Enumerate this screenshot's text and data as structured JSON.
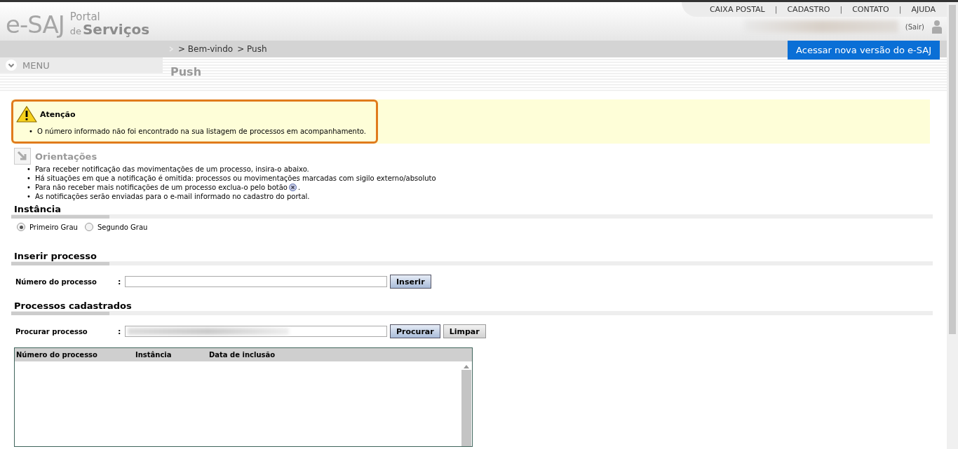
{
  "logo": {
    "mark": "e-SAJ",
    "line1": "Portal",
    "line2a": "de",
    "line2b": "Serviços"
  },
  "top_links": [
    "CAIXA POSTAL",
    "CADASTRO",
    "CONTATO",
    "AJUDA"
  ],
  "top_link_separators": [
    "|",
    "|",
    "|"
  ],
  "logout": "(Sair)",
  "breadcrumb": [
    "> Bem-vindo",
    "> Push"
  ],
  "new_version_button": "Acessar nova versão do e-SAJ",
  "menu": "MENU",
  "page_title": "Push",
  "alert": {
    "title": "Atenção",
    "items": [
      {
        "bullet": "•",
        "text": "O número informado não foi encontrado na sua listagem de processos em acompanhamento."
      }
    ]
  },
  "guidance": {
    "title": "Orientações",
    "items": [
      {
        "bullet": "•",
        "text": "Para receber notificação das movimentações de um processo, insira-o abaixo.",
        "icon": false
      },
      {
        "bullet": "•",
        "text": "Há situações em que a notificação é omitida: processos ou movimentações marcadas com sigilo externo/absoluto",
        "icon": false
      },
      {
        "bullet": "•",
        "text": "Para não receber mais notificações de um processo exclua-o pelo botão",
        "icon": true,
        "after": "."
      },
      {
        "bullet": "•",
        "text": "As notificações serão enviadas para o e-mail informado no cadastro do portal.",
        "icon": false
      }
    ]
  },
  "instancia": {
    "title": "Instância",
    "options": [
      {
        "label": "Primeiro Grau",
        "selected": true
      },
      {
        "label": "Segundo Grau",
        "selected": false
      }
    ]
  },
  "inserir": {
    "title": "Inserir processo",
    "label": "Número do processo",
    "sep": ":",
    "button": "Inserir"
  },
  "cadastrados": {
    "title": "Processos cadastrados",
    "label": "Procurar processo",
    "sep": ":",
    "buttons": [
      {
        "label": "Procurar",
        "kind": "primary"
      },
      {
        "label": "Limpar",
        "kind": "secondary"
      }
    ],
    "table": {
      "columns": [
        "Número do processo",
        "Instância",
        "Data de inclusão"
      ]
    }
  }
}
